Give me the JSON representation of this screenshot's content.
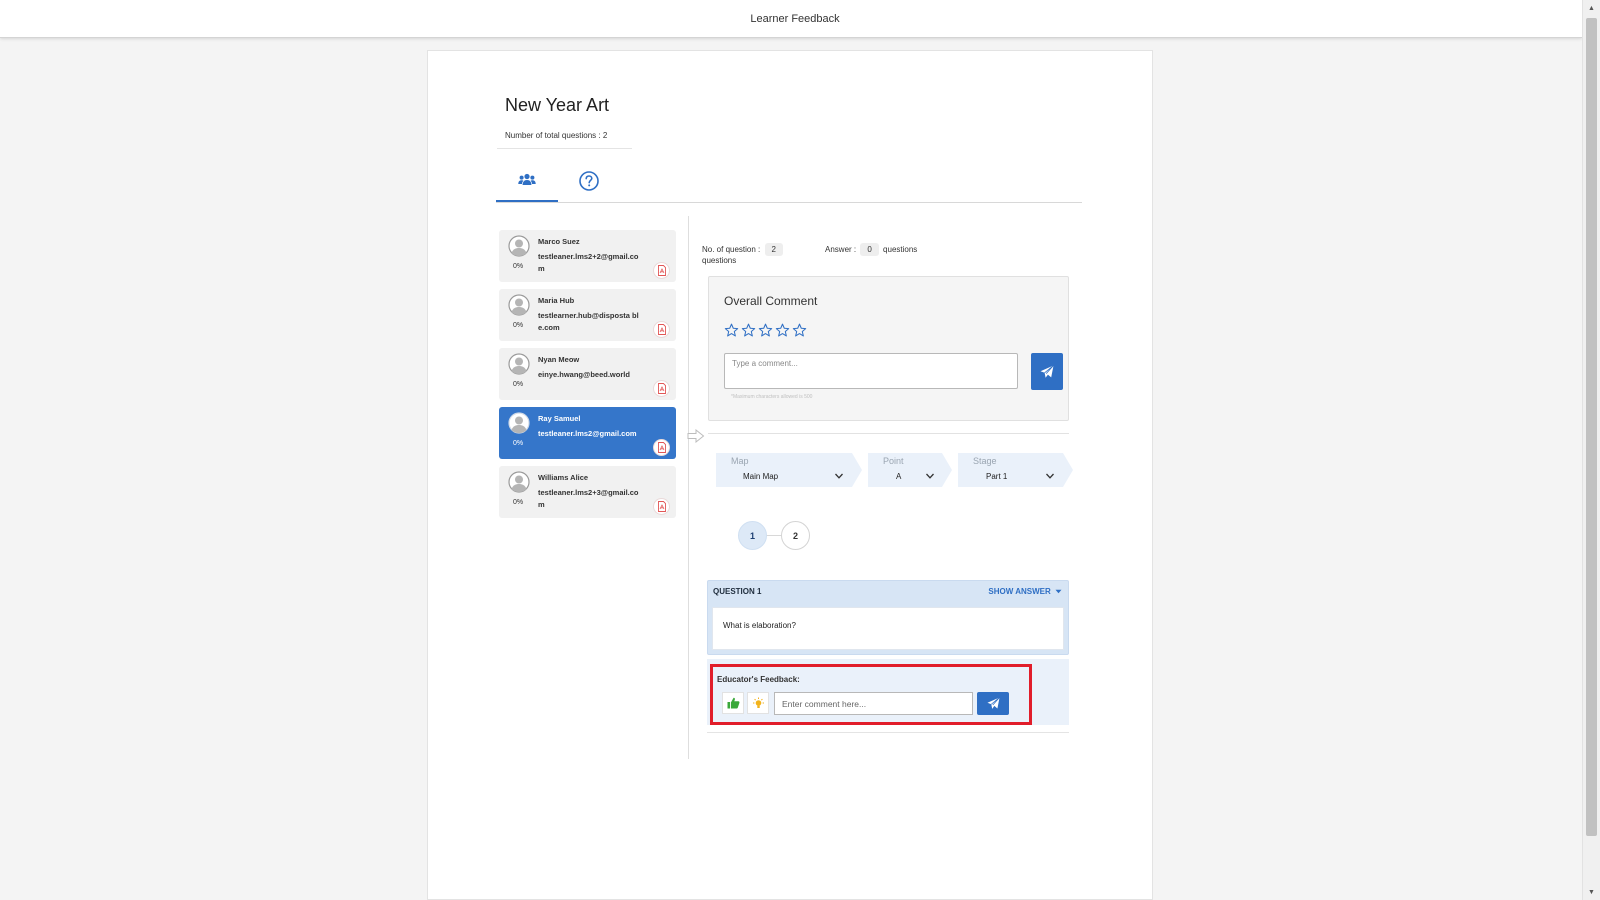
{
  "header": {
    "title": "Learner Feedback"
  },
  "assignment": {
    "title": "New Year Art",
    "total_questions_label": "Number of total questions : 2"
  },
  "tabs": [
    {
      "name": "learners",
      "icon": "users-icon",
      "active": true
    },
    {
      "name": "questions",
      "icon": "question-circle-icon",
      "active": false
    }
  ],
  "learners": [
    {
      "name": "Marco Suez",
      "email": "testleaner.lms2+2@gmail.com",
      "progress": "0%",
      "selected": false
    },
    {
      "name": "Maria Hub",
      "email": "testlearner.hub@disposta ble.com",
      "progress": "0%",
      "selected": false
    },
    {
      "name": "Nyan Meow",
      "email": "einye.hwang@beed.world",
      "progress": "0%",
      "selected": false
    },
    {
      "name": "Ray Samuel",
      "email": "testleaner.lms2@gmail.com",
      "progress": "0%",
      "selected": true
    },
    {
      "name": "Williams Alice",
      "email": "testleaner.lms2+3@gmail.com",
      "progress": "0%",
      "selected": false
    }
  ],
  "summary": {
    "question_label": "No. of question :",
    "question_count": "2",
    "question_suffix": "questions",
    "answer_label": "Answer :",
    "answer_count": "0",
    "answer_suffix": "questions"
  },
  "overall_comment": {
    "title": "Overall Comment",
    "rating": 0,
    "max_rating": 5,
    "placeholder": "Type a comment...",
    "max_note": "*Maximum characters allowed is 500"
  },
  "selectors": {
    "map": {
      "label": "Map",
      "value": "Main Map"
    },
    "point": {
      "label": "Point",
      "value": "A"
    },
    "stage": {
      "label": "Stage",
      "value": "Part 1"
    }
  },
  "steps": [
    "1",
    "2"
  ],
  "active_step": "1",
  "question": {
    "label": "QUESTION 1",
    "show_answer": "SHOW ANSWER",
    "text": "What is elaboration?"
  },
  "feedback": {
    "title": "Educator's Feedback:",
    "placeholder": "Enter comment here..."
  },
  "colors": {
    "accent": "#2f6fc4",
    "selected_learner": "#3576ca",
    "highlight_box": "#e11d2a",
    "thumb_green": "#3aa83a",
    "bulb_yellow": "#f2b21b",
    "pdf_red": "#e25656"
  }
}
